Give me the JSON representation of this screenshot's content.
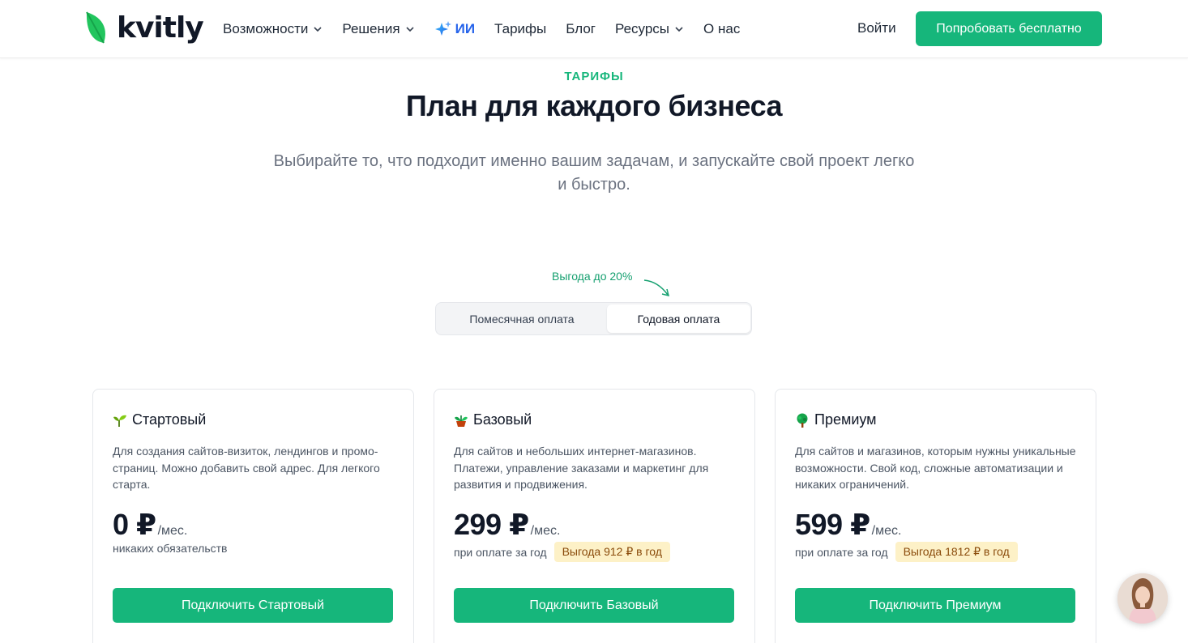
{
  "header": {
    "logo_text": "kvitly",
    "nav": [
      {
        "label": "Возможности",
        "has_dropdown": true
      },
      {
        "label": "Решения",
        "has_dropdown": true
      },
      {
        "label": "ИИ",
        "has_dropdown": false,
        "icon": "sparkles-icon"
      },
      {
        "label": "Тарифы",
        "has_dropdown": false
      },
      {
        "label": "Блог",
        "has_dropdown": false
      },
      {
        "label": "Ресурсы",
        "has_dropdown": true
      },
      {
        "label": "О нас",
        "has_dropdown": false
      }
    ],
    "login_label": "Войти",
    "cta_label": "Попробовать бесплатно"
  },
  "hero": {
    "eyebrow": "ТАРИФЫ",
    "title": "План для каждого бизнеса",
    "subtitle": "Выбирайте то, что подходит именно вашим задачам, и запускайте свой проект легко и быстро."
  },
  "billing": {
    "discount_note": "Выгода до 20%",
    "monthly_label": "Помесячная оплата",
    "yearly_label": "Годовая оплата",
    "selected": "yearly"
  },
  "plans": [
    {
      "icon": "seedling-icon",
      "name": "Стартовый",
      "description": "Для создания сайтов-визиток, лендингов и промо-страниц. Можно добавить свой адрес. Для легкого старта.",
      "price": "0 ₽",
      "unit": "/мес.",
      "note": "никаких обязательств",
      "savings": "",
      "button": "Подключить Стартовый"
    },
    {
      "icon": "potted-plant-icon",
      "name": "Базовый",
      "description": "Для сайтов и небольших интернет-магазинов. Платежи, управление заказами и маркетинг для развития и продвижения.",
      "price": "299 ₽",
      "unit": "/мес.",
      "note": "при оплате за год",
      "savings": "Выгода 912 ₽ в год",
      "button": "Подключить Базовый"
    },
    {
      "icon": "tree-icon",
      "name": "Премиум",
      "description": "Для сайтов и магазинов, которым нужны уникальные возможности. Свой код, сложные автоматизации и никаких ограничений.",
      "price": "599 ₽",
      "unit": "/мес.",
      "note": "при оплате за год",
      "savings": "Выгода 1812 ₽ в год",
      "button": "Подключить Премиум"
    }
  ],
  "colors": {
    "brand_green": "#16b67b",
    "ai_blue": "#2563eb",
    "savings_bg": "#fdf1c7",
    "savings_text": "#8a4b0b"
  }
}
